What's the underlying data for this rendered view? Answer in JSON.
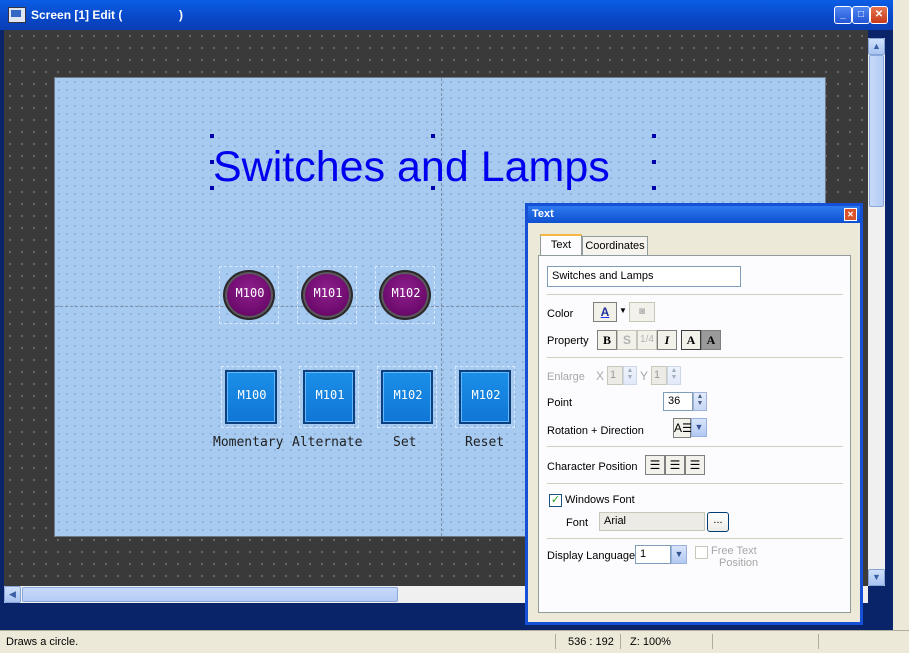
{
  "window": {
    "title": "Screen [1] Edit (                 )"
  },
  "canvas": {
    "title_text": "Switches and Lamps",
    "lamps": [
      {
        "label": "M100"
      },
      {
        "label": "M101"
      },
      {
        "label": "M102"
      }
    ],
    "switches": [
      {
        "label": "M100",
        "caption": "Momentary"
      },
      {
        "label": "M101",
        "caption": "Alternate"
      },
      {
        "label": "M102",
        "caption": "Set"
      },
      {
        "label": "M102",
        "caption": "Reset"
      }
    ]
  },
  "status": {
    "message": "Draws a circle.",
    "coordinates": "536 : 192",
    "zoom": "Z: 100%"
  },
  "panel": {
    "title": "Text",
    "tabs": [
      {
        "label": "Text",
        "active": true
      },
      {
        "label": "Coordinates",
        "active": false
      }
    ],
    "text_value": "Switches and Lamps",
    "color_label": "Color",
    "color_button": "A",
    "property_label": "Property",
    "property_buttons": {
      "bold": "B",
      "shadow": "S",
      "fraction": "1/4",
      "italic": "I",
      "normal": "A",
      "reverse": "A"
    },
    "enlarge_label": "Enlarge",
    "enlarge_x_label": "X",
    "enlarge_x": "1",
    "enlarge_y_label": "Y",
    "enlarge_y": "1",
    "point_label": "Point",
    "point_value": "36",
    "rotation_label": "Rotation + Direction",
    "char_position_label": "Character Position",
    "windows_font_label": "Windows Font",
    "windows_font_checked": true,
    "font_label": "Font",
    "font_value": "Arial",
    "browse_label": "...",
    "display_language_label": "Display Language",
    "display_language_value": "1",
    "free_text_label_1": "Free Text",
    "free_text_label_2": "Position"
  },
  "colors": {
    "titlebar": "#0847c7",
    "canvas_bg": "#3a3a3a",
    "screen_bg": "#a6caf0",
    "title_text": "#0000ee",
    "lamp": "#7a127a",
    "switch": "#1583e0"
  }
}
